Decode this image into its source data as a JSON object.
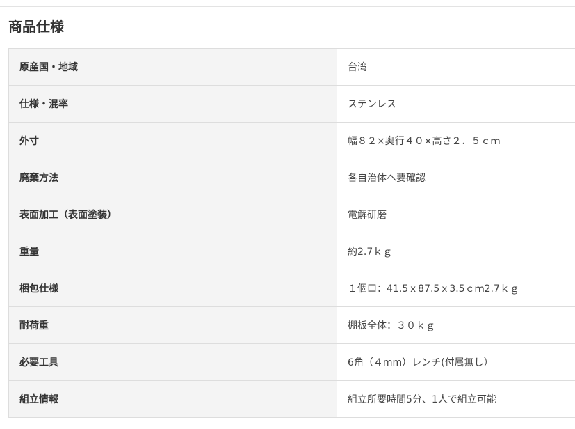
{
  "section": {
    "title": "商品仕様"
  },
  "spec_table": {
    "rows": [
      {
        "label": "原産国・地域",
        "value": "台湾"
      },
      {
        "label": "仕様・混率",
        "value": "ステンレス"
      },
      {
        "label": "外寸",
        "value": "幅８２×奥行４０×高さ２．５ｃｍ"
      },
      {
        "label": "廃棄方法",
        "value": "各自治体へ要確認"
      },
      {
        "label": "表面加工（表面塗装）",
        "value": "電解研磨"
      },
      {
        "label": "重量",
        "value": "約2.7ｋｇ"
      },
      {
        "label": "梱包仕様",
        "value": "１個口：41.5ｘ87.5ｘ3.5ｃｍ2.7ｋｇ"
      },
      {
        "label": "耐荷重",
        "value": "棚板全体：３０ｋｇ"
      },
      {
        "label": "必要工具",
        "value": "6角（４mm）レンチ(付属無し）"
      },
      {
        "label": "組立情報",
        "value": "組立所要時間5分、1人で組立可能"
      }
    ]
  }
}
